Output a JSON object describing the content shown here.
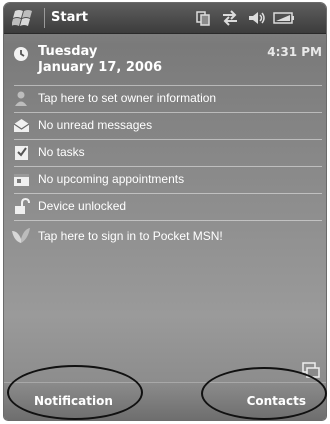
{
  "title_bar": {
    "start_label": "Start",
    "icons": [
      "windows-flag-icon",
      "connectivity-icon",
      "sync-arrows-icon",
      "volume-icon",
      "battery-icon"
    ]
  },
  "today": {
    "day": "Tuesday",
    "date": "January 17, 2006",
    "time": "4:31 PM"
  },
  "items": [
    {
      "icon": "owner-person-icon",
      "label": "Tap here to set owner information"
    },
    {
      "icon": "envelope-icon",
      "label": "No unread messages"
    },
    {
      "icon": "tasks-checkbox-icon",
      "label": "No tasks"
    },
    {
      "icon": "calendar-icon",
      "label": "No upcoming appointments"
    },
    {
      "icon": "unlocked-padlock-icon",
      "label": "Device unlocked"
    },
    {
      "icon": "msn-butterfly-icon",
      "label": "Tap here to sign in to Pocket MSN!"
    }
  ],
  "softkeys": {
    "left": "Notification",
    "right": "Contacts"
  },
  "input_icon": "keyboard-input-icon"
}
